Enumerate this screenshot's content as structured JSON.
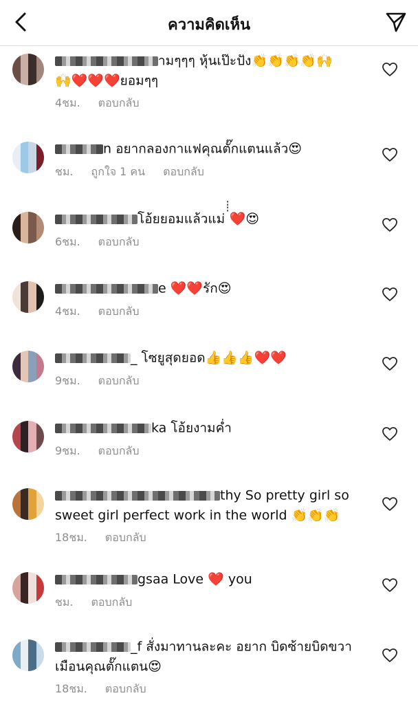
{
  "header": {
    "title": "ความคิดเห็น",
    "back_icon": "chevron-left-icon",
    "send_icon": "paper-plane-icon"
  },
  "comments": [
    {
      "line1": "ามๆๆๆ หุ้นเป๊ะปัง👏👏👏👏🙌",
      "line2": "🙌❤️❤️❤️ยอมๆๆ",
      "time": "4ชม.",
      "likes": "",
      "reply": "ตอบกลับ",
      "colors": [
        "#6b4f45",
        "#a3867c",
        "#3b2e2a",
        "#c9b0a7"
      ]
    },
    {
      "line1": "n อยากลองกาแฟคุณตั๊กแตนแล้ว😍",
      "line2": "",
      "time": "ชม.",
      "likes": "ถูกใจ 1 คน",
      "reply": "ตอบกลับ",
      "colors": [
        "#9ec9e6",
        "#e8eef5",
        "#7a1f2a",
        "#c8d6e4"
      ]
    },
    {
      "line1": "โอ้ยยอมแล้วแม่ ่่่่❤️😍",
      "line2": "",
      "time": "6ชม.",
      "likes": "",
      "reply": "ตอบกลับ",
      "colors": [
        "#7a5a4a",
        "#d9b59e",
        "#2b1d18",
        "#b38b74"
      ]
    },
    {
      "line1": "e ❤️❤️รัก😍",
      "line2": "",
      "time": "4ชม.",
      "likes": "",
      "reply": "ตอบกลับ",
      "colors": [
        "#1c1c1c",
        "#e1c2ae",
        "#4a3b36",
        "#f0e4da"
      ]
    },
    {
      "line1": "_ โซยูสุดยอด👍👍👍❤️❤️",
      "line2": "",
      "time": "9ชม.",
      "likes": "",
      "reply": "ตอบกลับ",
      "colors": [
        "#3c2a3e",
        "#c47a8c",
        "#8aa0b8",
        "#e2c7b6"
      ]
    },
    {
      "line1": "ka โอ้ยงามค่ำ",
      "line2": "",
      "time": "9ชม.",
      "likes": "",
      "reply": "ตอบกลับ",
      "colors": [
        "#2e2024",
        "#b5454f",
        "#6d4a4c",
        "#e2b0b4"
      ]
    },
    {
      "line1": "thy So pretty girl so",
      "line2": "sweet girl perfect work in the world 👏👏👏",
      "time": "18ชม.",
      "likes": "",
      "reply": "ตอบกลับ",
      "colors": [
        "#e0a23a",
        "#3a2a22",
        "#b8743a",
        "#f2d6a0"
      ]
    },
    {
      "line1": "gsaa Love ❤️ you",
      "line2": "",
      "time": "ชม.",
      "likes": "",
      "reply": "ตอบกลับ",
      "colors": [
        "#c53a3a",
        "#efe0dc",
        "#3a2424",
        "#d7a49c"
      ]
    },
    {
      "line1": "_f สั่งมาทานละคะ อยาก บิดซ้ายบิดขวา",
      "line2": "เมือนคุณตั๊กแตน😍",
      "time": "18ชม.",
      "likes": "",
      "reply": "ตอบกลับ",
      "colors": [
        "#7fa9c9",
        "#c8dcec",
        "#4b6d88",
        "#e8eff5"
      ]
    }
  ]
}
